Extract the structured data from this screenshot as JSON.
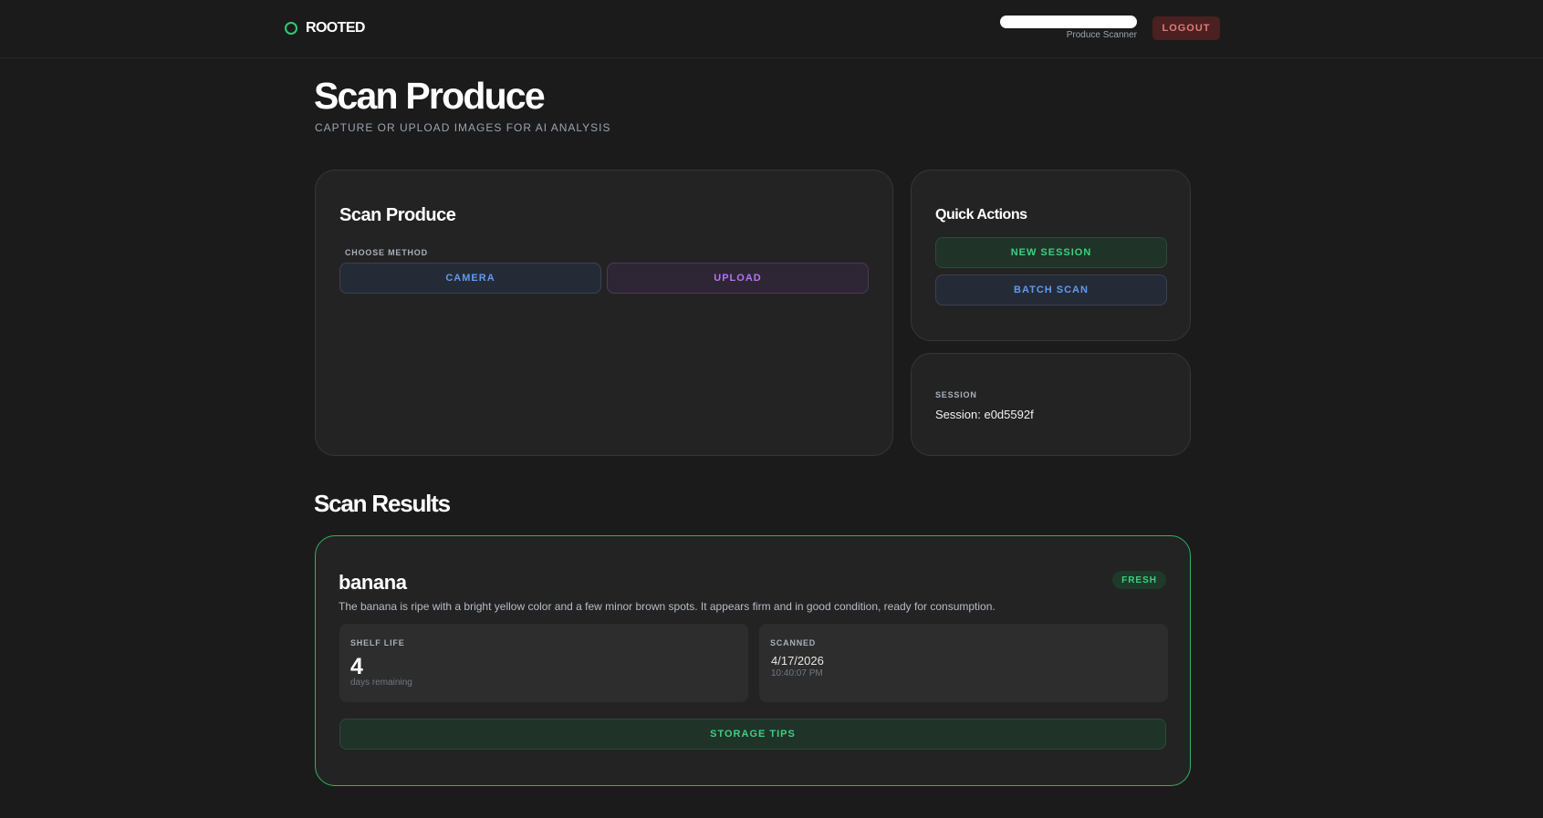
{
  "nav": {
    "brand": "ROOTED",
    "user_role": "Produce Scanner",
    "logout_label": "LOGOUT"
  },
  "header": {
    "title": "Scan Produce",
    "subtitle": "CAPTURE OR UPLOAD IMAGES FOR AI ANALYSIS"
  },
  "scan_card": {
    "title": "Scan Produce",
    "method_label": "CHOOSE METHOD",
    "camera_label": "CAMERA",
    "upload_label": "UPLOAD"
  },
  "quick_actions": {
    "title": "Quick Actions",
    "new_session_label": "NEW SESSION",
    "batch_scan_label": "BATCH SCAN"
  },
  "session": {
    "label": "SESSION",
    "value": "Session: e0d5592f"
  },
  "results": {
    "title": "Scan Results",
    "items": [
      {
        "name": "banana",
        "status": "FRESH",
        "description": "The banana is ripe with a bright yellow color and a few minor brown spots. It appears firm and in good condition, ready for consumption.",
        "shelf_life_label": "SHELF LIFE",
        "shelf_life_value": "4",
        "shelf_life_unit": "days remaining",
        "scanned_label": "SCANNED",
        "scanned_date": "4/17/2026",
        "scanned_time": "10:40:07 PM",
        "storage_tips_label": "STORAGE TIPS"
      }
    ]
  },
  "colors": {
    "background": "#1b1b1b",
    "card": "#232323",
    "accent_green": "#3ecf7f",
    "accent_blue": "#5f9af5",
    "accent_purple": "#b274f5",
    "danger": "#e07b7b",
    "result_border": "#2fb35f"
  }
}
